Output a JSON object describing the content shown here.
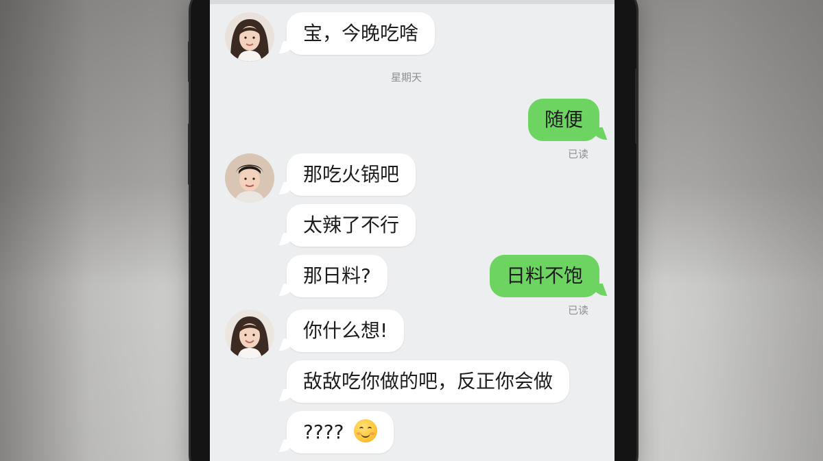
{
  "chat": {
    "messages": [
      {
        "id": "m1",
        "direction": "in",
        "text": "宝，今晚吃啥",
        "avatar": "female-avatar"
      },
      {
        "id": "m1_meta",
        "text": "星期天"
      },
      {
        "id": "m2",
        "direction": "out",
        "text": "随便"
      },
      {
        "id": "m2_meta",
        "text": "已读"
      },
      {
        "id": "m3",
        "direction": "in",
        "text": "那吃火锅吧",
        "avatar": "male-avatar"
      },
      {
        "id": "m4",
        "direction": "in",
        "text": "太辣了不行"
      },
      {
        "id": "m5",
        "direction": "in",
        "text": "那日料?"
      },
      {
        "id": "m6",
        "direction": "out",
        "text": "日料不饱"
      },
      {
        "id": "m6_meta",
        "text": "已读"
      },
      {
        "id": "m7",
        "direction": "in",
        "text": "你什么想!",
        "avatar": "female-avatar"
      },
      {
        "id": "m8",
        "direction": "in",
        "text": "敌敌吃你做的吧，反正你会做"
      },
      {
        "id": "m9",
        "direction": "in",
        "text": "????",
        "emoji": "smiling-face-emoji"
      }
    ]
  },
  "colors": {
    "outgoing_bubble": "#6dd461",
    "incoming_bubble": "#ffffff",
    "chat_background": "#edeeef"
  }
}
